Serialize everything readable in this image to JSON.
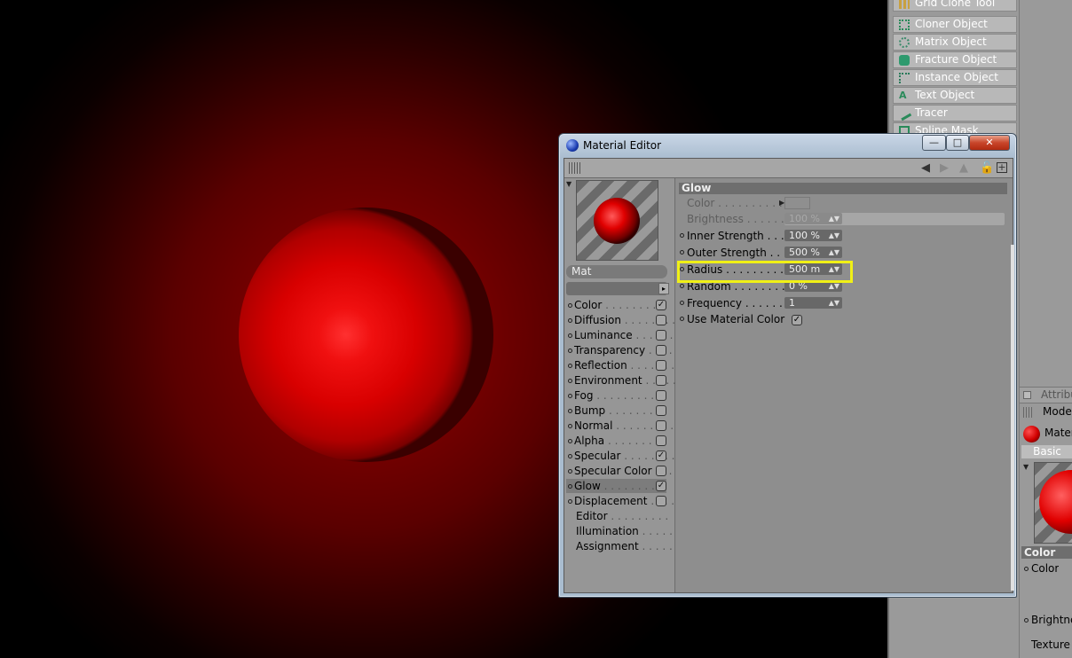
{
  "object_palette": {
    "items": [
      {
        "label": "Grid Clone Tool",
        "icon": "grid-clone-icon"
      },
      {
        "label": "Cloner Object",
        "icon": "cloner-icon"
      },
      {
        "label": "Matrix Object",
        "icon": "matrix-icon"
      },
      {
        "label": "Fracture Object",
        "icon": "fracture-icon"
      },
      {
        "label": "Instance Object",
        "icon": "instance-icon"
      },
      {
        "label": "Text Object",
        "icon": "text-object-icon"
      },
      {
        "label": "Tracer",
        "icon": "tracer-icon"
      },
      {
        "label": "Spline Mask",
        "icon": "spline-mask-icon"
      }
    ]
  },
  "window": {
    "title": "Material Editor",
    "minimize": "—",
    "maximize": "□",
    "close": "✕"
  },
  "material": {
    "name": "Mat",
    "channels": [
      {
        "label": "Color",
        "dot": true,
        "checked": true
      },
      {
        "label": "Diffusion",
        "dot": true,
        "checked": false
      },
      {
        "label": "Luminance",
        "dot": true,
        "checked": false
      },
      {
        "label": "Transparency",
        "dot": true,
        "checked": false
      },
      {
        "label": "Reflection",
        "dot": true,
        "checked": false
      },
      {
        "label": "Environment",
        "dot": true,
        "checked": false
      },
      {
        "label": "Fog",
        "dot": true,
        "checked": false
      },
      {
        "label": "Bump",
        "dot": true,
        "checked": false
      },
      {
        "label": "Normal",
        "dot": true,
        "checked": false
      },
      {
        "label": "Alpha",
        "dot": true,
        "checked": false
      },
      {
        "label": "Specular",
        "dot": true,
        "checked": true
      },
      {
        "label": "Specular Color",
        "dot": true,
        "checked": false
      },
      {
        "label": "Glow",
        "dot": true,
        "checked": true,
        "selected": true
      },
      {
        "label": "Displacement",
        "dot": true,
        "checked": false
      },
      {
        "label": "Editor",
        "dot": false
      },
      {
        "label": "Illumination",
        "dot": false
      },
      {
        "label": "Assignment",
        "dot": false
      }
    ]
  },
  "glow": {
    "header": "Glow",
    "color_label": "Color",
    "brightness_label": "Brightness",
    "brightness_value": "100 %",
    "inner_label": "Inner Strength",
    "inner_value": "100 %",
    "outer_label": "Outer Strength",
    "outer_value": "500 %",
    "radius_label": "Radius",
    "radius_value": "500 m",
    "random_label": "Random",
    "random_value": "0 %",
    "frequency_label": "Frequency",
    "frequency_value": "1",
    "use_material_color_label": "Use Material Color",
    "use_material_color_checked": true
  },
  "attributes": {
    "tab": "Attribu",
    "mode": "Mode",
    "material": "Mater",
    "basic": "Basic",
    "section": "Color",
    "color_label": "Color",
    "brightness_label": "Brightne",
    "texture_label": "Texture"
  },
  "colors": {
    "highlight": "#f0f016",
    "glow_red": "#e00000"
  }
}
